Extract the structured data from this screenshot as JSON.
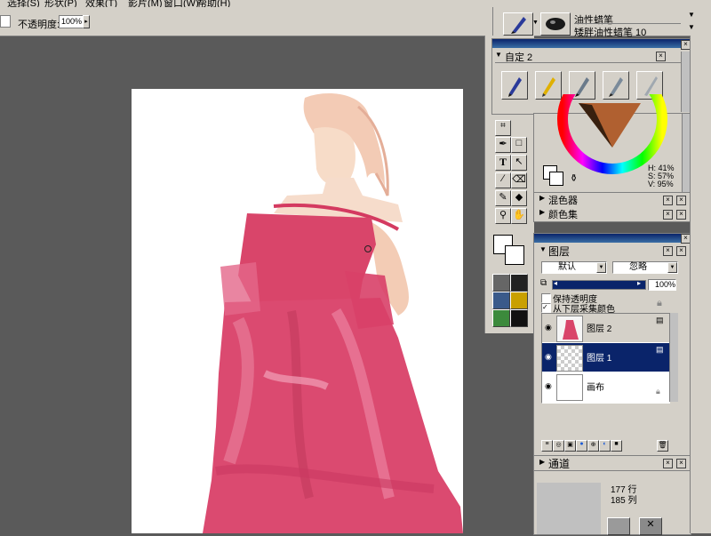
{
  "menubar": [
    "选择(S)",
    "形状(P)",
    "效果(T)",
    "影片(M)",
    "窗口(W)",
    "帮助(H)"
  ],
  "propbar": {
    "opacity_label": "不透明度:",
    "opacity_value": "100%"
  },
  "brush_selector": {
    "category": "油性蜡笔",
    "variant": "矮胖油性蜡笔 10"
  },
  "custom_palette": {
    "title": "自定 2",
    "brushes": [
      "pen-brush-icon",
      "pencil-brush-icon",
      "nib-brush-icon",
      "nib2-brush-icon",
      "knife-brush-icon"
    ]
  },
  "color_wheel": {
    "h": "H: 41%",
    "s": "S: 57%",
    "v": "V: 95%"
  },
  "sections": {
    "mixer": "混色器",
    "color_set": "颜色集",
    "channels": "通道"
  },
  "layers_panel": {
    "title": "图层",
    "composite_method": "默认",
    "composite_depth": "忽略",
    "opacity": "100%",
    "preserve_transparency": "保持透明度",
    "pick_up_color": "从下层采集颜色",
    "layers": [
      {
        "name": "图层 2",
        "selected": false
      },
      {
        "name": "图层 1",
        "selected": true
      },
      {
        "name": "画布",
        "selected": false
      }
    ]
  },
  "info_panel": {
    "rows": "177 行",
    "cols": "185 列"
  },
  "colors": {
    "dress": "#d9456a",
    "selection": "#0a246a",
    "panel_bg": "#d4d0c8",
    "workspace": "#5a5a5a"
  }
}
